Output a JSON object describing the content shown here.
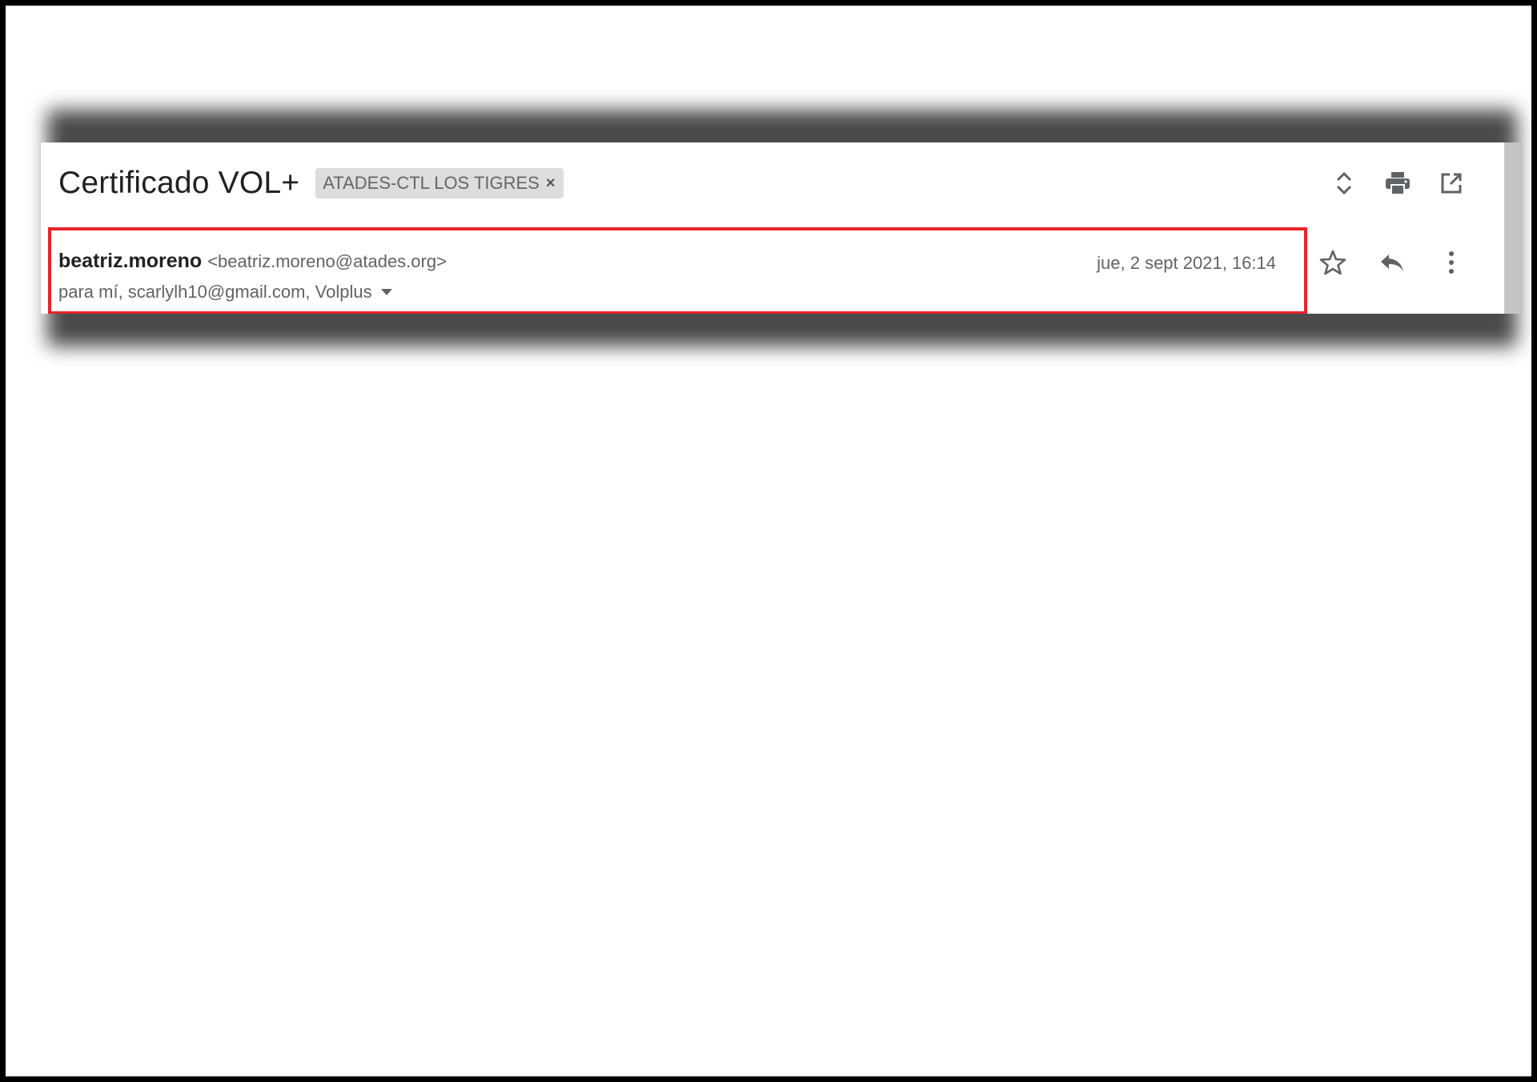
{
  "email": {
    "subject": "Certificado VOL+",
    "label": {
      "name": "ATADES-CTL LOS TIGRES",
      "remove_glyph": "×"
    },
    "toolbar_icons": [
      "expand-collapse-icon",
      "print-icon",
      "open-in-new-window-icon"
    ],
    "message": {
      "sender_name": "beatriz.moreno",
      "sender_email": "<beatriz.moreno@atades.org>",
      "recipients": "para mí, scarlylh10@gmail.com, Volplus",
      "timestamp": "jue, 2 sept 2021, 16:14",
      "action_icons": [
        "star-icon",
        "reply-icon",
        "more-vert-icon"
      ]
    }
  },
  "colors": {
    "highlight": "#e8232a",
    "label_chip": "#dddddd",
    "icon": "#5f6368"
  }
}
